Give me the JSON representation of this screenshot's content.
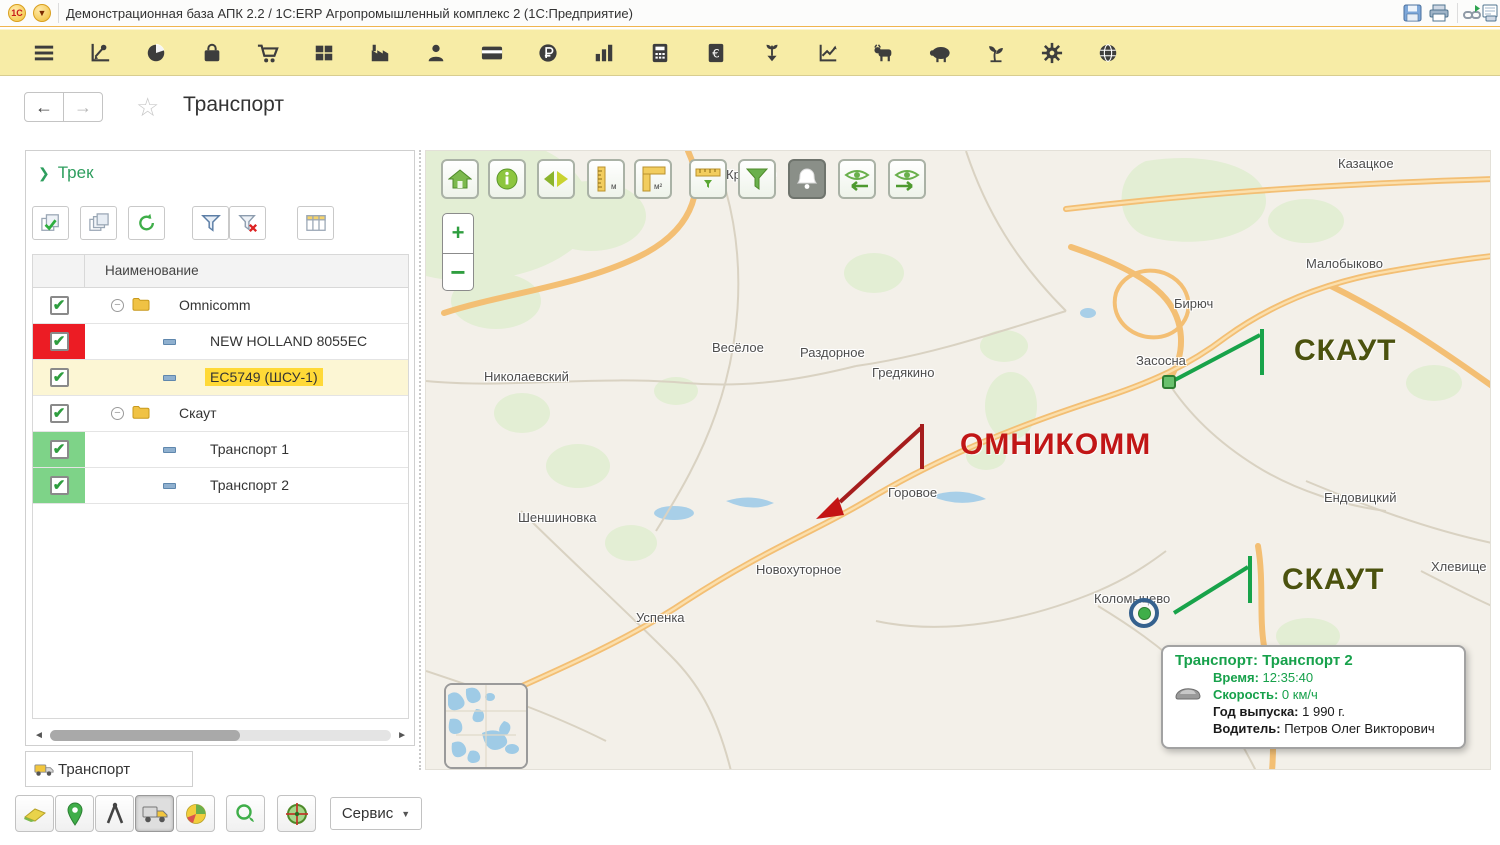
{
  "window": {
    "title": "Демонстрационная база АПК 2.2 / 1С:ERP Агропромышленный комплекс 2  (1С:Предприятие)",
    "logo_text": "1С",
    "action_icons": [
      "save-icon",
      "print-icon",
      "get-link-icon",
      "print-preview-icon"
    ]
  },
  "main_menu_icon_names": [
    "menu-icon",
    "planning-icon",
    "pie-chart-icon",
    "purchases-bag-icon",
    "sales-cart-icon",
    "warehouse-grid-icon",
    "production-factory-icon",
    "hr-person-icon",
    "bank-card-icon",
    "money-ruble-icon",
    "bar-chart-icon",
    "calculator-icon",
    "euro-finance-icon",
    "harvest-down-icon",
    "agro-planning-icon",
    "cattle-cow-icon",
    "pig-icon",
    "sprout-icon",
    "gear-settings-icon",
    "globe-icon"
  ],
  "nav": {
    "page_title": "Транспорт",
    "back": "←",
    "forward": "→",
    "favorite_star": "☆"
  },
  "track_panel": {
    "section_title": "Трек",
    "section_chevron": "❯",
    "toolbar_icon_names": [
      "check-all-icon",
      "copy-pages-icon",
      "refresh-icon",
      "filter-icon",
      "filter-clear-icon",
      "columns-icon"
    ],
    "table": {
      "column_header": "Наименование",
      "rows": [
        {
          "label": "Omnicomm",
          "type": "group",
          "checked": true
        },
        {
          "label": "NEW HOLLAND 8055EC",
          "type": "item",
          "checked": true,
          "check_cell_color": "#ec1c24"
        },
        {
          "label": "EC5749 (ШСУ-1)",
          "type": "item",
          "checked": true,
          "selected": true,
          "highlight_color": "#ffd937"
        },
        {
          "label": "Скаут",
          "type": "group",
          "checked": true
        },
        {
          "label": "Транспорт 1",
          "type": "item",
          "checked": true,
          "check_cell_color": "#7ed388"
        },
        {
          "label": "Транспорт 2",
          "type": "item",
          "checked": true,
          "check_cell_color": "#7ed388"
        }
      ],
      "checkmark": "✔"
    },
    "tab_label": "Транспорт"
  },
  "map": {
    "toolbar_icon_names": [
      "home-icon",
      "info-icon",
      "pan-arrows-icon",
      "measure-length-icon",
      "measure-area-icon",
      "measure-route-icon",
      "filter-funnel-icon",
      "alerts-bell-icon",
      "track-back-eye-icon",
      "track-forward-eye-icon"
    ],
    "zoom_in_label": "+",
    "zoom_out_label": "−",
    "places": [
      {
        "name": "Казацкое"
      },
      {
        "name": "Малобыково"
      },
      {
        "name": "Бирюч"
      },
      {
        "name": "Засосна"
      },
      {
        "name": "Весёлое"
      },
      {
        "name": "Раздорное"
      },
      {
        "name": "Гредякино"
      },
      {
        "name": "Николаевский"
      },
      {
        "name": "Горовое"
      },
      {
        "name": "Шеншиновка"
      },
      {
        "name": "Новохуторное"
      },
      {
        "name": "Успенка"
      },
      {
        "name": "Коломыцево"
      },
      {
        "name": "Ендовицкий"
      },
      {
        "name": "Хлевище"
      },
      {
        "name": "Красное"
      }
    ],
    "annotations": [
      {
        "text": "СКАУТ",
        "color": "#4b520e"
      },
      {
        "text": "ОМНИКОММ",
        "color": "#c11616"
      },
      {
        "text": "СКАУТ",
        "color": "#4b520e"
      }
    ],
    "tooltip": {
      "title": "Транспорт: Транспорт 2",
      "rows": [
        {
          "label": "Время:",
          "value": " 12:35:40",
          "color": "#17a14b"
        },
        {
          "label": "Скорость:",
          "value": " 0 км/ч",
          "color": "#17a14b"
        },
        {
          "label": "Год выпуска:",
          "value": " 1 990 г.",
          "color": "#1a1a1a"
        },
        {
          "label": "Водитель:",
          "value": " Петров Олег Викторович",
          "color": "#1a1a1a"
        }
      ]
    }
  },
  "bottom_toolbar": {
    "icon_names": [
      "fields-icon",
      "placemark-icon",
      "compass-icon",
      "transport-truck-icon",
      "pie-icon",
      "search-icon",
      "locate-crosshair-icon"
    ],
    "service_button_label": "Сервис",
    "service_caret": "▼"
  },
  "colors": {
    "toolbar_yellow": "#f7eca6",
    "accent_green": "#2e9e5e",
    "checkbox_red_bg": "#ec1c24",
    "checkbox_green_bg": "#7ed388",
    "selection_yellow": "#ffd937",
    "callout_green": "#18a34a",
    "callout_dark_red": "#a51d1d",
    "annotation_skaut": "#4b520e",
    "annotation_omnicomm": "#c11616",
    "tooltip_green": "#17a14b"
  }
}
